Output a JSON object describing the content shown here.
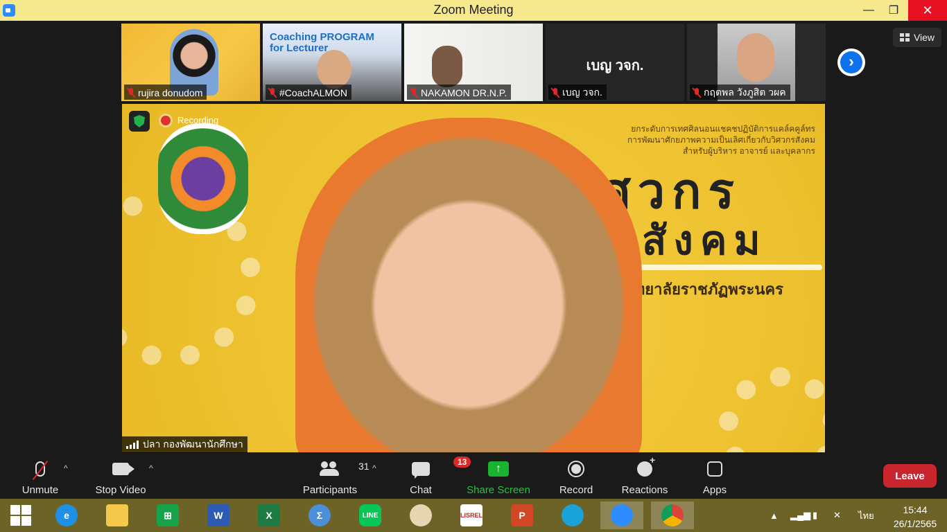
{
  "window": {
    "title": "Zoom Meeting",
    "minimize": "—",
    "maximize": "❐",
    "close": "✕"
  },
  "view_button": {
    "label": "View"
  },
  "thumbnails": [
    {
      "name": "rujira donudom",
      "muted": true
    },
    {
      "name": "#CoachALMON",
      "muted": true,
      "banner": "Coaching PROGRAM\nfor Lecturer"
    },
    {
      "name": "NAKAMON DR.N.P.",
      "muted": true
    },
    {
      "name": "เบญ วจก.",
      "muted": true,
      "display_text": "เบญ วจก."
    },
    {
      "name": "กฤตพล วังภูสิต วผค",
      "muted": true
    }
  ],
  "next_page": {
    "icon": "chevron-right-icon"
  },
  "speaker": {
    "name": "ปลา กองพัฒนานักศึกษา",
    "recording_label": "Recording",
    "slide": {
      "heading_line1": "ยกระดับการเทศศิลนอนแชคชปฏิบัติการแคล์คคูล์ทร",
      "heading_line2": "การพัฒนาศักยภาพความเป็นเลิศเกี่ยวกับวิศวกรสังคม",
      "heading_line3": "สำหรับผู้บริหาร อาจารย์ และบุคลากร",
      "title_line1": "วิศวกร",
      "title_line2": "สังคม",
      "university": "มหาวิทยาลัยราชภัฏพระนคร"
    }
  },
  "toolbar": {
    "unmute": "Unmute",
    "stop_video": "Stop Video",
    "participants": "Participants",
    "participants_count": "31",
    "chat": "Chat",
    "chat_badge": "13",
    "share_screen": "Share Screen",
    "record": "Record",
    "reactions": "Reactions",
    "apps": "Apps",
    "leave": "Leave",
    "caret": "^"
  },
  "taskbar": {
    "apps": [
      "start",
      "internet-explorer",
      "file-explorer",
      "store",
      "word",
      "excel",
      "math-input",
      "line",
      "paint",
      "lisrel",
      "powerpoint",
      "edge",
      "zoom",
      "chrome"
    ],
    "language": "ไทย",
    "time": "15:44",
    "date": "26/1/2565",
    "tray_up": "▲"
  },
  "colors": {
    "title_bar": "#f6e88c",
    "taskbar": "#6d6326",
    "leave": "#c8252c",
    "share": "#19b32f",
    "accent": "#0e72ed"
  }
}
